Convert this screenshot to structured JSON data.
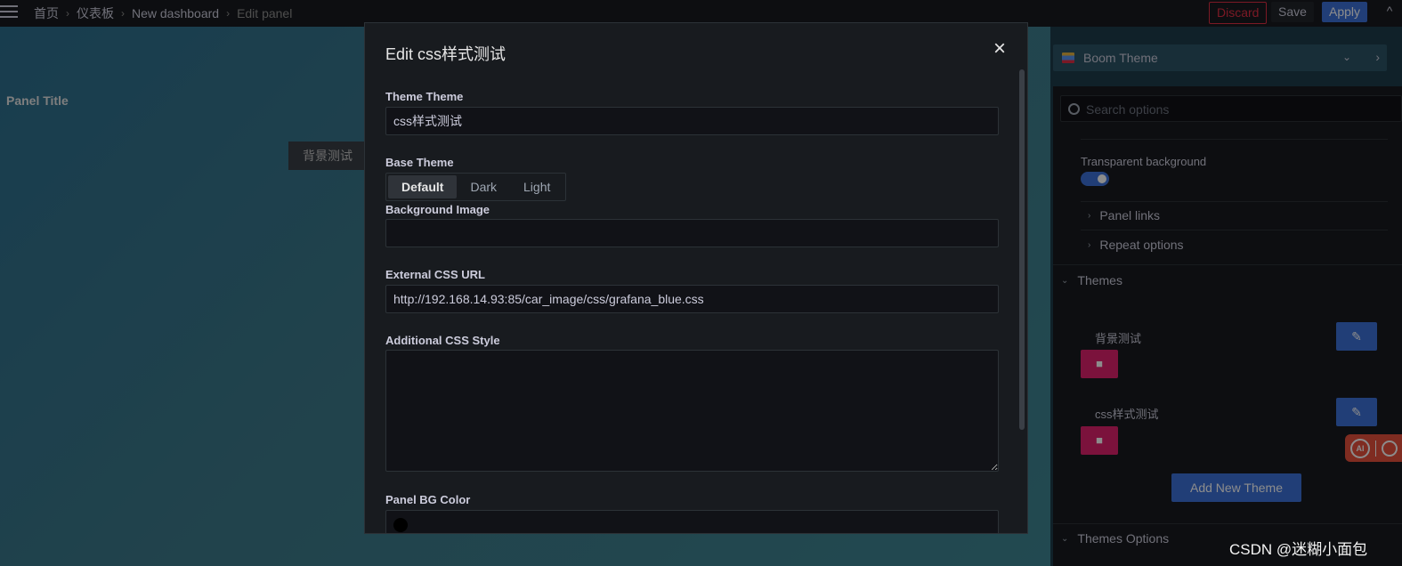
{
  "topbar": {
    "breadcrumbs": [
      "首页",
      "仪表板",
      "New dashboard",
      "Edit panel"
    ],
    "separator": "›",
    "discard_label": "Discard",
    "save_label": "Save",
    "apply_label": "Apply",
    "collapse_glyph": "^"
  },
  "canvas": {
    "panel_title": "Panel Title",
    "chip_label": "背景测试",
    "background_colors": [
      "#2d6f8f",
      "#3e8694"
    ]
  },
  "options_pane": {
    "visualization": "Boom Theme",
    "search_placeholder": "Search options",
    "transparent_bg_label": "Transparent background",
    "transparent_bg_enabled": true,
    "sections": [
      "Panel links",
      "Repeat options"
    ],
    "themes_section": "Themes",
    "themes": [
      {
        "name": "背景测试"
      },
      {
        "name": "css样式测试"
      }
    ],
    "add_theme_label": "Add New Theme",
    "themes_options_section": "Themes Options"
  },
  "modal": {
    "title": "Edit css样式测试",
    "theme_name_label": "Theme Theme",
    "theme_name_value": "css样式测试",
    "base_theme_label": "Base Theme",
    "base_theme_options": [
      "Default",
      "Dark",
      "Light"
    ],
    "base_theme_selected": "Default",
    "background_image_label": "Background Image",
    "background_image_value": "",
    "external_css_label": "External CSS URL",
    "external_css_value": "http://192.168.14.93:85/car_image/css/grafana_blue.css",
    "additional_css_label": "Additional CSS Style",
    "additional_css_value": "",
    "panel_bg_color_label": "Panel BG Color",
    "panel_bg_color": "#000000"
  },
  "floating_tool": {
    "label": "AI"
  },
  "watermark": "CSDN @迷糊小面包",
  "colors": {
    "accent": "#3d71d9",
    "danger": "#e02f44",
    "delete": "#e0226e",
    "modal_bg": "#181b1f"
  }
}
